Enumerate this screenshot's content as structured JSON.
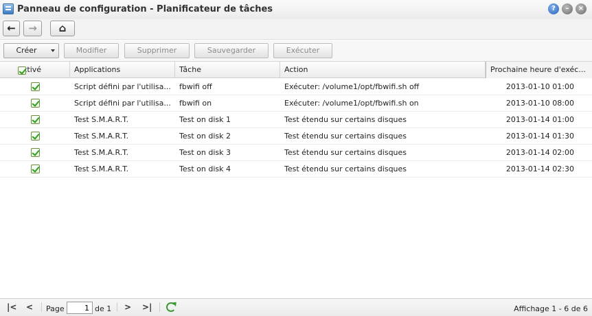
{
  "window": {
    "title": "Panneau de configuration - Planificateur de tâches"
  },
  "toolbar": {
    "create": "Créer",
    "modify": "Modifier",
    "delete": "Supprimer",
    "save": "Sauvegarder",
    "execute": "Exécuter"
  },
  "columns": {
    "enabled": "Activé",
    "applications": "Applications",
    "task": "Tâche",
    "action": "Action",
    "next_run": "Prochaine heure d'exéc..."
  },
  "rows": [
    {
      "enabled": true,
      "application": "Script défini par l'utilisa...",
      "task": "fbwifi off",
      "action": "Exécuter: /volume1/opt/fbwifi.sh off",
      "next_run": "2013-01-10 01:00"
    },
    {
      "enabled": true,
      "application": "Script défini par l'utilisa...",
      "task": "fbwifi on",
      "action": "Exécuter: /volume1/opt/fbwifi.sh on",
      "next_run": "2013-01-10 08:00"
    },
    {
      "enabled": true,
      "application": "Test S.M.A.R.T.",
      "task": "Test on disk 1",
      "action": "Test étendu sur certains disques",
      "next_run": "2013-01-14 01:00"
    },
    {
      "enabled": true,
      "application": "Test S.M.A.R.T.",
      "task": "Test on disk 2",
      "action": "Test étendu sur certains disques",
      "next_run": "2013-01-14 01:30"
    },
    {
      "enabled": true,
      "application": "Test S.M.A.R.T.",
      "task": "Test on disk 3",
      "action": "Test étendu sur certains disques",
      "next_run": "2013-01-14 02:00"
    },
    {
      "enabled": true,
      "application": "Test S.M.A.R.T.",
      "task": "Test on disk 4",
      "action": "Test étendu sur certains disques",
      "next_run": "2013-01-14 02:30"
    }
  ],
  "pager": {
    "page_label": "Page",
    "page_value": "1",
    "of_label": "de 1",
    "info": "Affichage 1 - 6 de 6"
  },
  "colors": {
    "check_green": "#2e9c22",
    "accent_blue": "#2b63b8"
  }
}
